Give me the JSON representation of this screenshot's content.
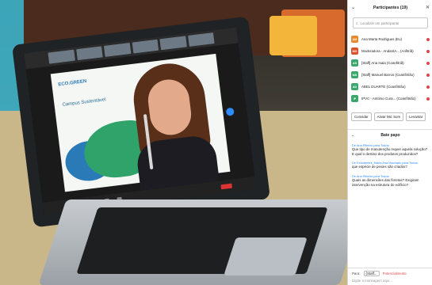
{
  "panel": {
    "title": "Participantes (19)",
    "search_placeholder": "Localizar um participante",
    "participants": [
      {
        "initials": "AM",
        "name": "Ana Marta Rodrigues (Eu)",
        "color": "#e98a2e"
      },
      {
        "initials": "MO",
        "name": "Moderadora - AndantA... (Anfitriã)",
        "color": "#d9532c"
      },
      {
        "initials": "AS",
        "name": "[Staff] Ana Isaia (Coanfitriã)",
        "color": "#3aa76d"
      },
      {
        "initials": "MS",
        "name": "[Staff] Manuel Barros (Coanfitrião)",
        "color": "#3aa76d"
      },
      {
        "initials": "AD",
        "name": "ABEL DUARTE (Coanfitrião)",
        "color": "#3aa76d"
      },
      {
        "initials": "IP",
        "name": "IPVC - António Cura... (Coanfitrião)",
        "color": "#3aa76d"
      }
    ],
    "buttons": [
      "Convidar",
      "Ativar Mic Som",
      "Levantar"
    ],
    "chat_title": "Bate papo",
    "messages": [
      {
        "from": "De Ana Ribeiro para Todos:",
        "text": "Que tipo de manutenção requer aquela solução? E qual o destino dos produtos produzidos?"
      },
      {
        "from": "De Estudantes_Maria Ana Machado para Todos:",
        "text": "que espécie de peixes são criados?"
      },
      {
        "from": "De Ana Ribeiro para Todos:",
        "text": "Quais as dimensões das floretas? Exigiram intervenção na estrutura do edifício?"
      }
    ],
    "footer": {
      "to_label": "Para:",
      "to_value": "(Staff...",
      "warning": "Potencialmente",
      "placeholder": "Digite a mensagem aqui..."
    }
  },
  "slide": {
    "logo": "ECO.GREEN",
    "title": "Campus Sustentável"
  }
}
